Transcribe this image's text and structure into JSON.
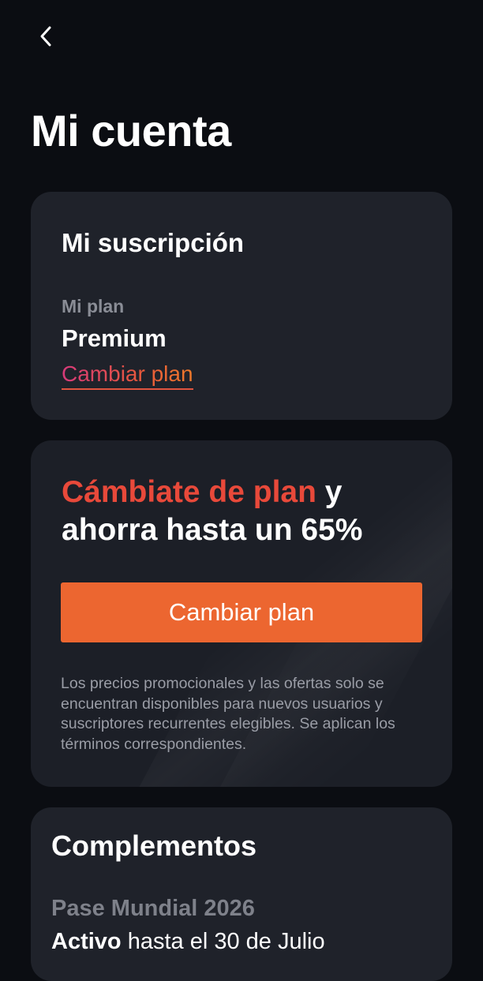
{
  "header": {
    "back_icon": "chevron-left-icon",
    "title": "Mi cuenta"
  },
  "subscription": {
    "heading": "Mi suscripción",
    "plan_label": "Mi plan",
    "plan_value": "Premium",
    "change_link": "Cambiar plan"
  },
  "promo": {
    "headline_accent": "Cámbiate de plan",
    "headline_rest": " y ahorra hasta un 65%",
    "button_label": "Cambiar plan",
    "disclaimer": "Los precios promocionales y las ofertas solo se encuentran disponibles para nuevos usuarios y suscriptores recurrentes elegibles. Se aplican los términos correspondientes."
  },
  "addons": {
    "heading": "Complementos",
    "items": [
      {
        "name": "Pase Mundial 2026",
        "status": "Activo",
        "status_suffix": " hasta el 30 de Julio"
      }
    ]
  },
  "colors": {
    "background": "#0b0d12",
    "card": "#1f222a",
    "accent_orange": "#ec6630",
    "accent_red": "#e8493a",
    "muted_text": "#8a8d96"
  }
}
